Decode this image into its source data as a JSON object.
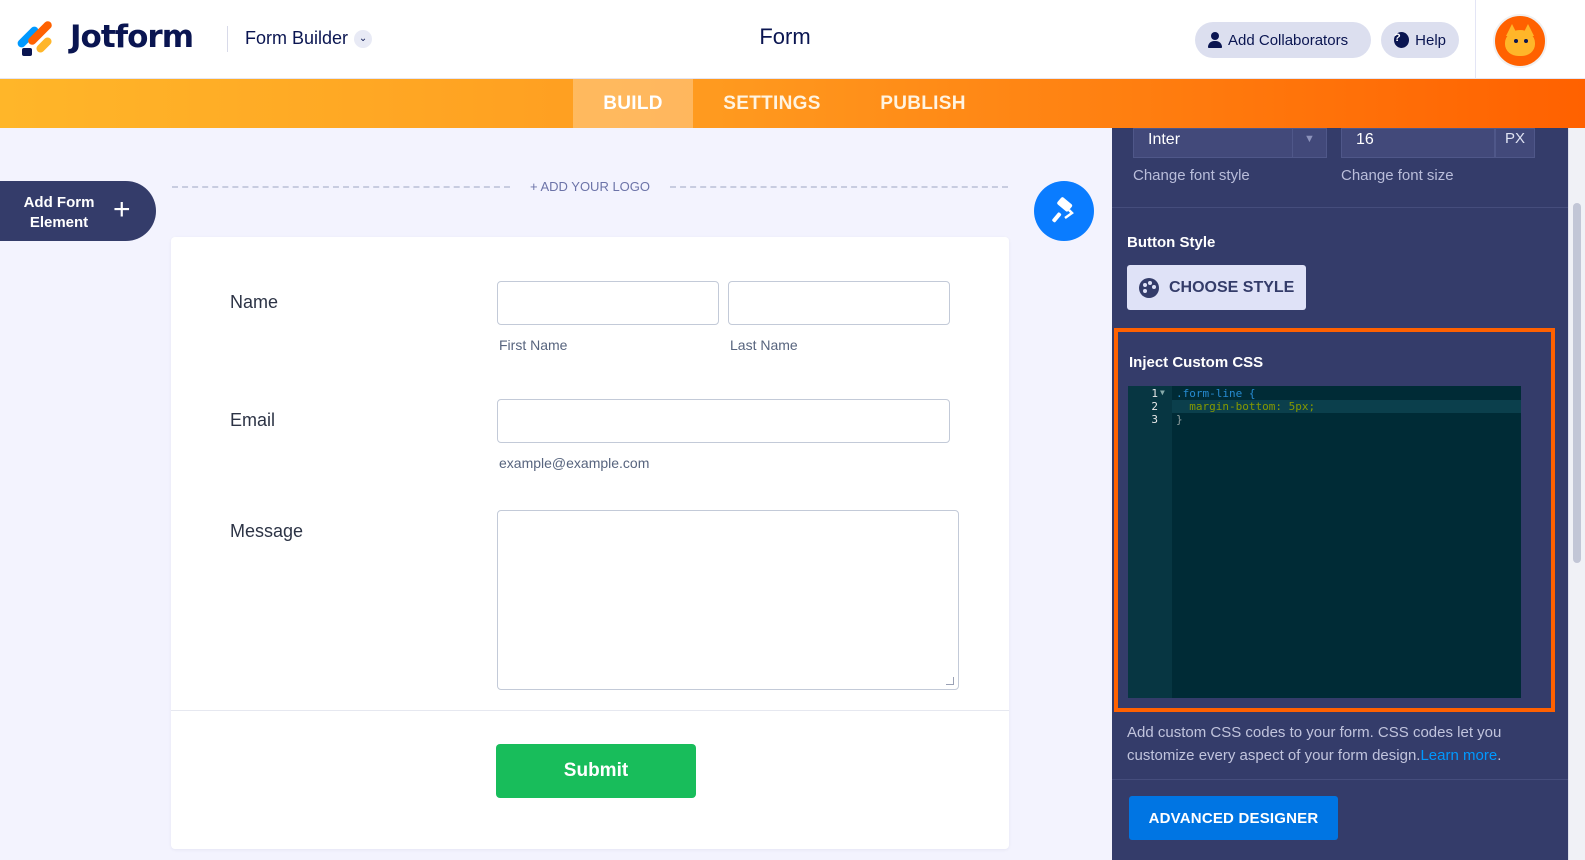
{
  "header": {
    "brand": "Jotform",
    "builder_menu": "Form Builder",
    "form_title": "Form",
    "add_collaborators": "Add Collaborators",
    "help": "Help"
  },
  "nav": {
    "tabs": [
      {
        "label": "BUILD",
        "active": true
      },
      {
        "label": "SETTINGS",
        "active": false
      },
      {
        "label": "PUBLISH",
        "active": false
      }
    ]
  },
  "builder": {
    "add_element": "Add Form Element",
    "add_logo": "+ ADD YOUR LOGO"
  },
  "form": {
    "name_label": "Name",
    "first_name_sub": "First Name",
    "last_name_sub": "Last Name",
    "email_label": "Email",
    "email_sub": "example@example.com",
    "message_label": "Message",
    "submit_label": "Submit"
  },
  "panel": {
    "font_value": "Inter",
    "font_size_value": "16",
    "font_size_unit": "PX",
    "font_style_caption": "Change font style",
    "font_size_caption": "Change font size",
    "button_style_title": "Button Style",
    "choose_style_label": "CHOOSE STYLE",
    "custom_css_title": "Inject Custom CSS",
    "css_lines": [
      ".form-line {",
      "  margin-bottom: 5px;",
      "}"
    ],
    "help_text": "Add custom CSS codes to your form. CSS codes let you customize every aspect of your form design.",
    "learn_more": "Learn more",
    "help_period": ".",
    "advanced_designer_label": "ADVANCED DESIGNER"
  },
  "colors": {
    "brand_orange": "#ff6100",
    "panel_bg": "#343c6a",
    "submit_green": "#18bd5b",
    "accent_blue": "#0a7cff"
  }
}
